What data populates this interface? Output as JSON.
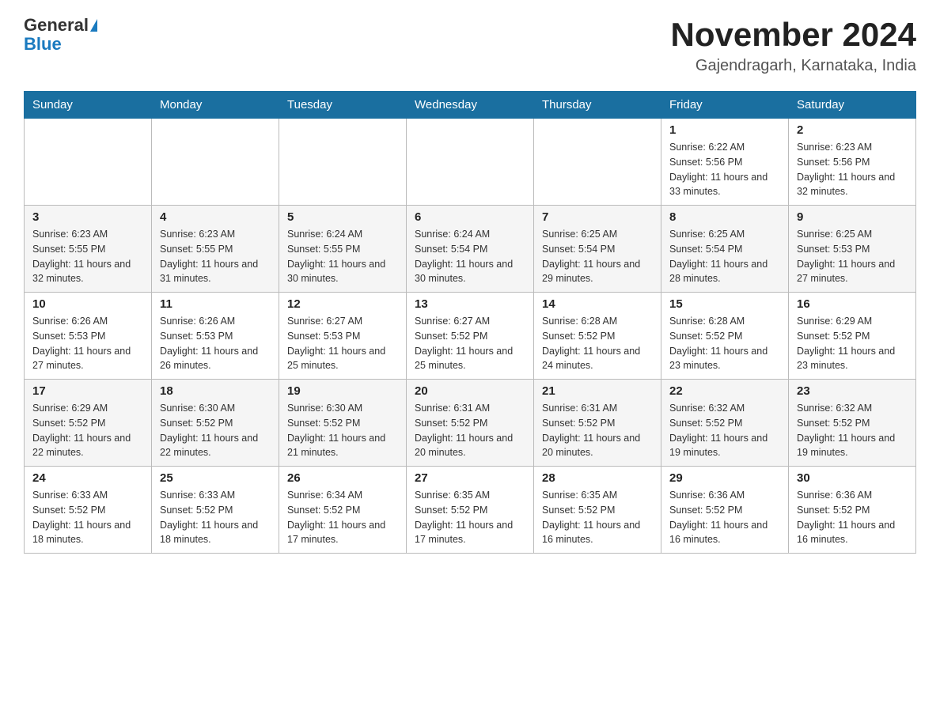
{
  "header": {
    "logo_general": "General",
    "logo_blue": "Blue",
    "month": "November 2024",
    "location": "Gajendragarh, Karnataka, India"
  },
  "days_of_week": [
    "Sunday",
    "Monday",
    "Tuesday",
    "Wednesday",
    "Thursday",
    "Friday",
    "Saturday"
  ],
  "weeks": [
    [
      {
        "day": "",
        "info": ""
      },
      {
        "day": "",
        "info": ""
      },
      {
        "day": "",
        "info": ""
      },
      {
        "day": "",
        "info": ""
      },
      {
        "day": "",
        "info": ""
      },
      {
        "day": "1",
        "info": "Sunrise: 6:22 AM\nSunset: 5:56 PM\nDaylight: 11 hours and 33 minutes."
      },
      {
        "day": "2",
        "info": "Sunrise: 6:23 AM\nSunset: 5:56 PM\nDaylight: 11 hours and 32 minutes."
      }
    ],
    [
      {
        "day": "3",
        "info": "Sunrise: 6:23 AM\nSunset: 5:55 PM\nDaylight: 11 hours and 32 minutes."
      },
      {
        "day": "4",
        "info": "Sunrise: 6:23 AM\nSunset: 5:55 PM\nDaylight: 11 hours and 31 minutes."
      },
      {
        "day": "5",
        "info": "Sunrise: 6:24 AM\nSunset: 5:55 PM\nDaylight: 11 hours and 30 minutes."
      },
      {
        "day": "6",
        "info": "Sunrise: 6:24 AM\nSunset: 5:54 PM\nDaylight: 11 hours and 30 minutes."
      },
      {
        "day": "7",
        "info": "Sunrise: 6:25 AM\nSunset: 5:54 PM\nDaylight: 11 hours and 29 minutes."
      },
      {
        "day": "8",
        "info": "Sunrise: 6:25 AM\nSunset: 5:54 PM\nDaylight: 11 hours and 28 minutes."
      },
      {
        "day": "9",
        "info": "Sunrise: 6:25 AM\nSunset: 5:53 PM\nDaylight: 11 hours and 27 minutes."
      }
    ],
    [
      {
        "day": "10",
        "info": "Sunrise: 6:26 AM\nSunset: 5:53 PM\nDaylight: 11 hours and 27 minutes."
      },
      {
        "day": "11",
        "info": "Sunrise: 6:26 AM\nSunset: 5:53 PM\nDaylight: 11 hours and 26 minutes."
      },
      {
        "day": "12",
        "info": "Sunrise: 6:27 AM\nSunset: 5:53 PM\nDaylight: 11 hours and 25 minutes."
      },
      {
        "day": "13",
        "info": "Sunrise: 6:27 AM\nSunset: 5:52 PM\nDaylight: 11 hours and 25 minutes."
      },
      {
        "day": "14",
        "info": "Sunrise: 6:28 AM\nSunset: 5:52 PM\nDaylight: 11 hours and 24 minutes."
      },
      {
        "day": "15",
        "info": "Sunrise: 6:28 AM\nSunset: 5:52 PM\nDaylight: 11 hours and 23 minutes."
      },
      {
        "day": "16",
        "info": "Sunrise: 6:29 AM\nSunset: 5:52 PM\nDaylight: 11 hours and 23 minutes."
      }
    ],
    [
      {
        "day": "17",
        "info": "Sunrise: 6:29 AM\nSunset: 5:52 PM\nDaylight: 11 hours and 22 minutes."
      },
      {
        "day": "18",
        "info": "Sunrise: 6:30 AM\nSunset: 5:52 PM\nDaylight: 11 hours and 22 minutes."
      },
      {
        "day": "19",
        "info": "Sunrise: 6:30 AM\nSunset: 5:52 PM\nDaylight: 11 hours and 21 minutes."
      },
      {
        "day": "20",
        "info": "Sunrise: 6:31 AM\nSunset: 5:52 PM\nDaylight: 11 hours and 20 minutes."
      },
      {
        "day": "21",
        "info": "Sunrise: 6:31 AM\nSunset: 5:52 PM\nDaylight: 11 hours and 20 minutes."
      },
      {
        "day": "22",
        "info": "Sunrise: 6:32 AM\nSunset: 5:52 PM\nDaylight: 11 hours and 19 minutes."
      },
      {
        "day": "23",
        "info": "Sunrise: 6:32 AM\nSunset: 5:52 PM\nDaylight: 11 hours and 19 minutes."
      }
    ],
    [
      {
        "day": "24",
        "info": "Sunrise: 6:33 AM\nSunset: 5:52 PM\nDaylight: 11 hours and 18 minutes."
      },
      {
        "day": "25",
        "info": "Sunrise: 6:33 AM\nSunset: 5:52 PM\nDaylight: 11 hours and 18 minutes."
      },
      {
        "day": "26",
        "info": "Sunrise: 6:34 AM\nSunset: 5:52 PM\nDaylight: 11 hours and 17 minutes."
      },
      {
        "day": "27",
        "info": "Sunrise: 6:35 AM\nSunset: 5:52 PM\nDaylight: 11 hours and 17 minutes."
      },
      {
        "day": "28",
        "info": "Sunrise: 6:35 AM\nSunset: 5:52 PM\nDaylight: 11 hours and 16 minutes."
      },
      {
        "day": "29",
        "info": "Sunrise: 6:36 AM\nSunset: 5:52 PM\nDaylight: 11 hours and 16 minutes."
      },
      {
        "day": "30",
        "info": "Sunrise: 6:36 AM\nSunset: 5:52 PM\nDaylight: 11 hours and 16 minutes."
      }
    ]
  ]
}
